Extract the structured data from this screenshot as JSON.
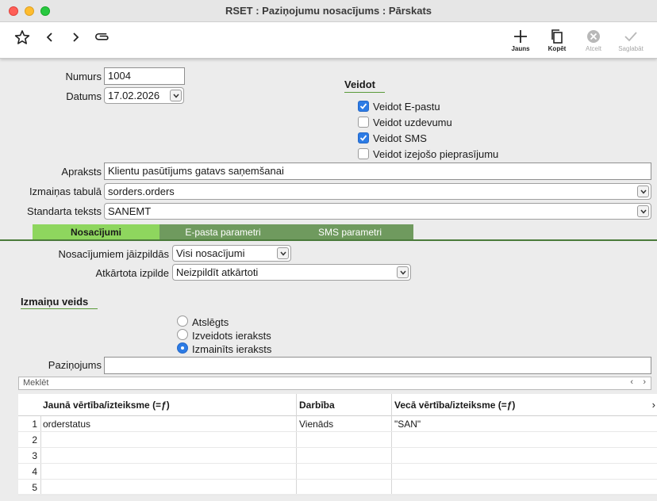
{
  "window": {
    "title": "RSET : Paziņojumu nosacījums : Pārskats"
  },
  "toolbar": {
    "icons": [
      "star-icon",
      "chevron-left-icon",
      "chevron-right-icon",
      "paperclip-icon"
    ],
    "new_label": "Jauns",
    "copy_label": "Kopēt",
    "cancel_label": "Atcelt",
    "save_label": "Saglabāt"
  },
  "form": {
    "number_label": "Numurs",
    "number_value": "1004",
    "date_label": "Datums",
    "date_value": "17.02.2026",
    "description_label": "Apraksts",
    "description_value": "Klientu pasūtījums gatavs saņemšanai",
    "table_label": "Izmaiņas tabulā",
    "table_value": "sorders.orders",
    "std_text_label": "Standarta teksts",
    "std_text_value": "SANEMT"
  },
  "create": {
    "heading": "Veidot",
    "options": [
      {
        "label": "Veidot E-pastu",
        "checked": true
      },
      {
        "label": "Veidot uzdevumu",
        "checked": false
      },
      {
        "label": "Veidot SMS",
        "checked": true
      },
      {
        "label": "Veidot izejošo pieprasījumu",
        "checked": false
      }
    ]
  },
  "tabs": [
    {
      "label": "Nosacījumi",
      "active": true
    },
    {
      "label": "E-pasta parametri",
      "active": false
    },
    {
      "label": "SMS parametri",
      "active": false
    }
  ],
  "conditions": {
    "fulfill_label": "Nosacījumiem jāizpildās",
    "fulfill_value": "Visi nosacījumi",
    "repeat_label": "Atkārtota izpilde",
    "repeat_value": "Neizpildīt atkārtoti"
  },
  "change_type": {
    "heading": "Izmaiņu veids",
    "options": [
      {
        "label": "Atslēgts",
        "selected": false
      },
      {
        "label": "Izveidots ieraksts",
        "selected": false
      },
      {
        "label": "Izmainīts ieraksts",
        "selected": true
      }
    ]
  },
  "notification": {
    "label": "Paziņojums",
    "value": ""
  },
  "search": {
    "placeholder": "Meklēt"
  },
  "grid": {
    "columns": [
      "Jaunā vērtība/izteiksme (=ƒ)",
      "Darbība",
      "Vecā vērtība/izteiksme (=ƒ)"
    ],
    "rows": [
      {
        "n": "1",
        "new": "orderstatus",
        "op": "Vienāds",
        "old": "\"SAN\""
      },
      {
        "n": "2",
        "new": "",
        "op": "",
        "old": ""
      },
      {
        "n": "3",
        "new": "",
        "op": "",
        "old": ""
      },
      {
        "n": "4",
        "new": "",
        "op": "",
        "old": ""
      },
      {
        "n": "5",
        "new": "",
        "op": "",
        "old": ""
      }
    ]
  },
  "colors": {
    "tab_active": "#8ed65e",
    "tab_inactive": "#6f9a5e",
    "checkbox": "#2c7be5"
  }
}
